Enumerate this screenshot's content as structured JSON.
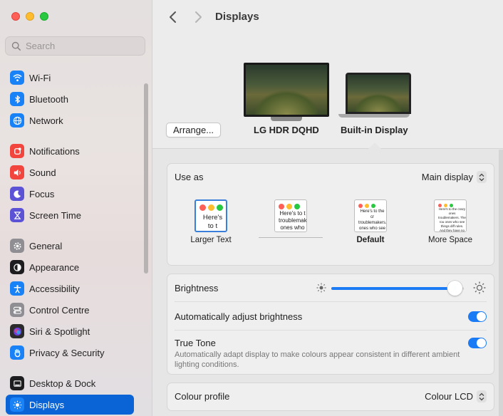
{
  "window": {
    "title": "Displays"
  },
  "search": {
    "placeholder": "Search"
  },
  "sidebar": {
    "items": [
      {
        "label": "Wi-Fi",
        "icon": "wifi-icon",
        "color": "#1a82f7"
      },
      {
        "label": "Bluetooth",
        "icon": "bluetooth-icon",
        "color": "#1a82f7"
      },
      {
        "label": "Network",
        "icon": "globe-icon",
        "color": "#1a82f7"
      },
      {
        "label": "Notifications",
        "icon": "bell-icon",
        "color": "#f1453d"
      },
      {
        "label": "Sound",
        "icon": "speaker-icon",
        "color": "#f1453d"
      },
      {
        "label": "Focus",
        "icon": "moon-icon",
        "color": "#5b52d6"
      },
      {
        "label": "Screen Time",
        "icon": "hourglass-icon",
        "color": "#5b52d6"
      },
      {
        "label": "General",
        "icon": "gear-icon",
        "color": "#8e8e93"
      },
      {
        "label": "Appearance",
        "icon": "appearance-icon",
        "color": "#1d1d1f"
      },
      {
        "label": "Accessibility",
        "icon": "accessibility-icon",
        "color": "#1a82f7"
      },
      {
        "label": "Control Centre",
        "icon": "toggles-icon",
        "color": "#8e8e93"
      },
      {
        "label": "Siri & Spotlight",
        "icon": "siri-icon",
        "color": "#2b2b2b"
      },
      {
        "label": "Privacy & Security",
        "icon": "hand-icon",
        "color": "#1a82f7"
      },
      {
        "label": "Desktop & Dock",
        "icon": "dock-icon",
        "color": "#1d1d1f"
      },
      {
        "label": "Displays",
        "icon": "sun-icon",
        "color": "#1a82f7",
        "selected": true
      }
    ]
  },
  "displays": {
    "arrange_label": "Arrange...",
    "external_name": "LG HDR DQHD",
    "builtin_name": "Built-in Display"
  },
  "use_as": {
    "label": "Use as",
    "value": "Main display"
  },
  "resolution_options": [
    {
      "label": "Larger Text",
      "sample": "Here's to t troublem"
    },
    {
      "label": "",
      "sample": "Here's to t troublemak ones who"
    },
    {
      "label": "Default",
      "sample": "Here's to the cr troublemakers. ones who see th rules. And they"
    },
    {
      "label": "More Space",
      "sample": "Here's to the crazy ones troublemakers. The rou ones who see things diff rules. And they have no can quote them, disagr them. About the only thi Because they change th"
    }
  ],
  "brightness": {
    "label": "Brightness",
    "level": 0.93
  },
  "auto_brightness": {
    "label": "Automatically adjust brightness",
    "on": true
  },
  "true_tone": {
    "label": "True Tone",
    "on": true,
    "description": "Automatically adapt display to make colours appear consistent in different ambient lighting conditions."
  },
  "colour_profile": {
    "label": "Colour profile",
    "value": "Colour LCD"
  },
  "colors": {
    "accent": "#0a64d6",
    "toggle": "#1a7bf5"
  }
}
